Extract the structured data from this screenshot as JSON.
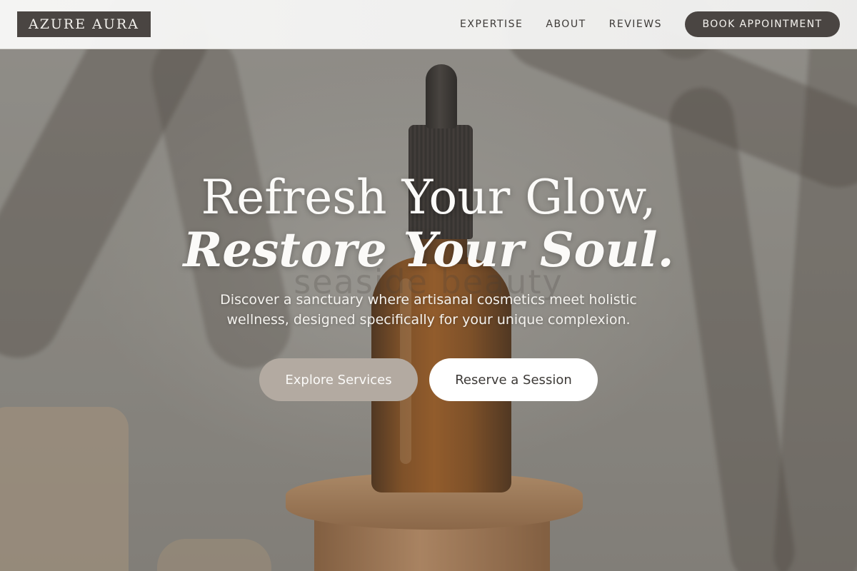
{
  "brand": {
    "logo_text": "AZURE AURA"
  },
  "nav": {
    "links": [
      {
        "label": "EXPERTISE"
      },
      {
        "label": "ABOUT"
      },
      {
        "label": "REVIEWS"
      }
    ],
    "book_label": "BOOK APPOINTMENT"
  },
  "hero": {
    "title_line1": "Refresh Your Glow,",
    "title_line2": "Restore Your Soul.",
    "background_text": "seaside beauty",
    "subtitle": "Discover a sanctuary where artisanal cosmetics meet holistic wellness, designed specifically for your unique complexion.",
    "primary_cta": "Explore Services",
    "secondary_cta": "Reserve a Session"
  },
  "colors": {
    "header_bg": "#f3f3f2",
    "dark_accent": "#4a4542",
    "explore_button": "#b3aaa1",
    "reserve_button": "#ffffff"
  }
}
